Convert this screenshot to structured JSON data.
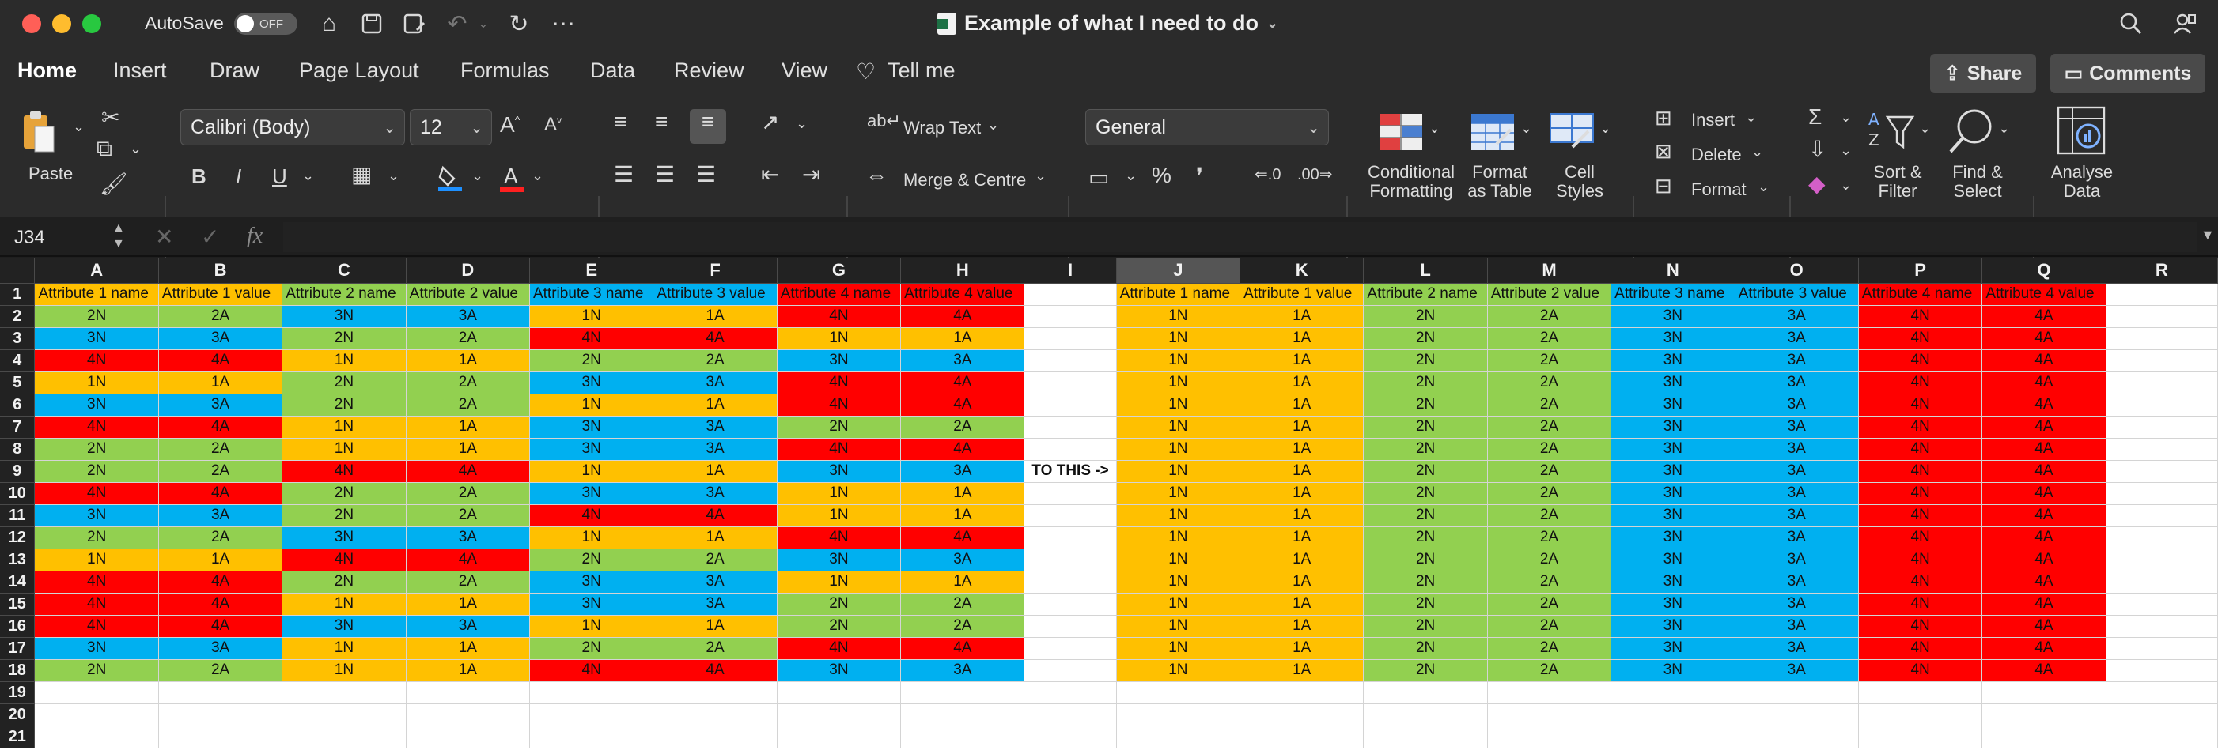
{
  "window": {
    "autosave_label": "AutoSave",
    "autosave_state": "OFF",
    "title": "Example of what I need to do",
    "traffic_colors": [
      "#ff5f57",
      "#febc2e",
      "#28c840"
    ]
  },
  "menu_tabs": [
    "Home",
    "Insert",
    "Draw",
    "Page Layout",
    "Formulas",
    "Data",
    "Review",
    "View",
    "Tell me"
  ],
  "header_buttons": {
    "share": "Share",
    "comments": "Comments"
  },
  "ribbon": {
    "paste": "Paste",
    "font_name": "Calibri (Body)",
    "font_size": "12",
    "bold": "B",
    "italic": "I",
    "underline": "U",
    "wrap_text": "Wrap Text",
    "merge_centre": "Merge & Centre",
    "number_format": "General",
    "percent": "%",
    "comma": "❜",
    "conditional_formatting": [
      "Conditional",
      "Formatting"
    ],
    "format_as_table": [
      "Format",
      "as Table"
    ],
    "cell_styles": [
      "Cell",
      "Styles"
    ],
    "insert": "Insert",
    "delete": "Delete",
    "format": "Format",
    "sort_filter": [
      "Sort &",
      "Filter"
    ],
    "find_select": [
      "Find &",
      "Select"
    ],
    "analyse_data": [
      "Analyse",
      "Data"
    ]
  },
  "formula_bar": {
    "name_box": "J34",
    "fx": "fx",
    "value": ""
  },
  "sheet": {
    "columns": [
      "A",
      "B",
      "C",
      "D",
      "E",
      "F",
      "G",
      "H",
      "I",
      "J",
      "K",
      "L",
      "M",
      "N",
      "O",
      "P",
      "Q",
      "R"
    ],
    "selected_column": "J",
    "headers": [
      "Attribute 1 name",
      "Attribute 1 value",
      "Attribute 2 name",
      "Attribute 2 value",
      "Attribute 3 name",
      "Attribute 3 value",
      "Attribute 4 name",
      "Attribute 4 value"
    ],
    "note_row": 9,
    "note_text": "TO THIS ->",
    "colors": {
      "1": "#ffc000",
      "2": "#92d050",
      "3": "#00b0f0",
      "4": "#ff0000"
    },
    "left_rows": [
      [
        "2N",
        "2A",
        "3N",
        "3A",
        "1N",
        "1A",
        "4N",
        "4A"
      ],
      [
        "3N",
        "3A",
        "2N",
        "2A",
        "4N",
        "4A",
        "1N",
        "1A"
      ],
      [
        "4N",
        "4A",
        "1N",
        "1A",
        "2N",
        "2A",
        "3N",
        "3A"
      ],
      [
        "1N",
        "1A",
        "2N",
        "2A",
        "3N",
        "3A",
        "4N",
        "4A"
      ],
      [
        "3N",
        "3A",
        "2N",
        "2A",
        "1N",
        "1A",
        "4N",
        "4A"
      ],
      [
        "4N",
        "4A",
        "1N",
        "1A",
        "3N",
        "3A",
        "2N",
        "2A"
      ],
      [
        "2N",
        "2A",
        "1N",
        "1A",
        "3N",
        "3A",
        "4N",
        "4A"
      ],
      [
        "2N",
        "2A",
        "4N",
        "4A",
        "1N",
        "1A",
        "3N",
        "3A"
      ],
      [
        "4N",
        "4A",
        "2N",
        "2A",
        "3N",
        "3A",
        "1N",
        "1A"
      ],
      [
        "3N",
        "3A",
        "2N",
        "2A",
        "4N",
        "4A",
        "1N",
        "1A"
      ],
      [
        "2N",
        "2A",
        "3N",
        "3A",
        "1N",
        "1A",
        "4N",
        "4A"
      ],
      [
        "1N",
        "1A",
        "4N",
        "4A",
        "2N",
        "2A",
        "3N",
        "3A"
      ],
      [
        "4N",
        "4A",
        "2N",
        "2A",
        "3N",
        "3A",
        "1N",
        "1A"
      ],
      [
        "4N",
        "4A",
        "1N",
        "1A",
        "3N",
        "3A",
        "2N",
        "2A"
      ],
      [
        "4N",
        "4A",
        "3N",
        "3A",
        "1N",
        "1A",
        "2N",
        "2A"
      ],
      [
        "3N",
        "3A",
        "1N",
        "1A",
        "2N",
        "2A",
        "4N",
        "4A"
      ],
      [
        "2N",
        "2A",
        "1N",
        "1A",
        "4N",
        "4A",
        "3N",
        "3A"
      ]
    ],
    "right_row": [
      "1N",
      "1A",
      "2N",
      "2A",
      "3N",
      "3A",
      "4N",
      "4A"
    ],
    "right_row_count": 17,
    "visible_rows": 21
  }
}
